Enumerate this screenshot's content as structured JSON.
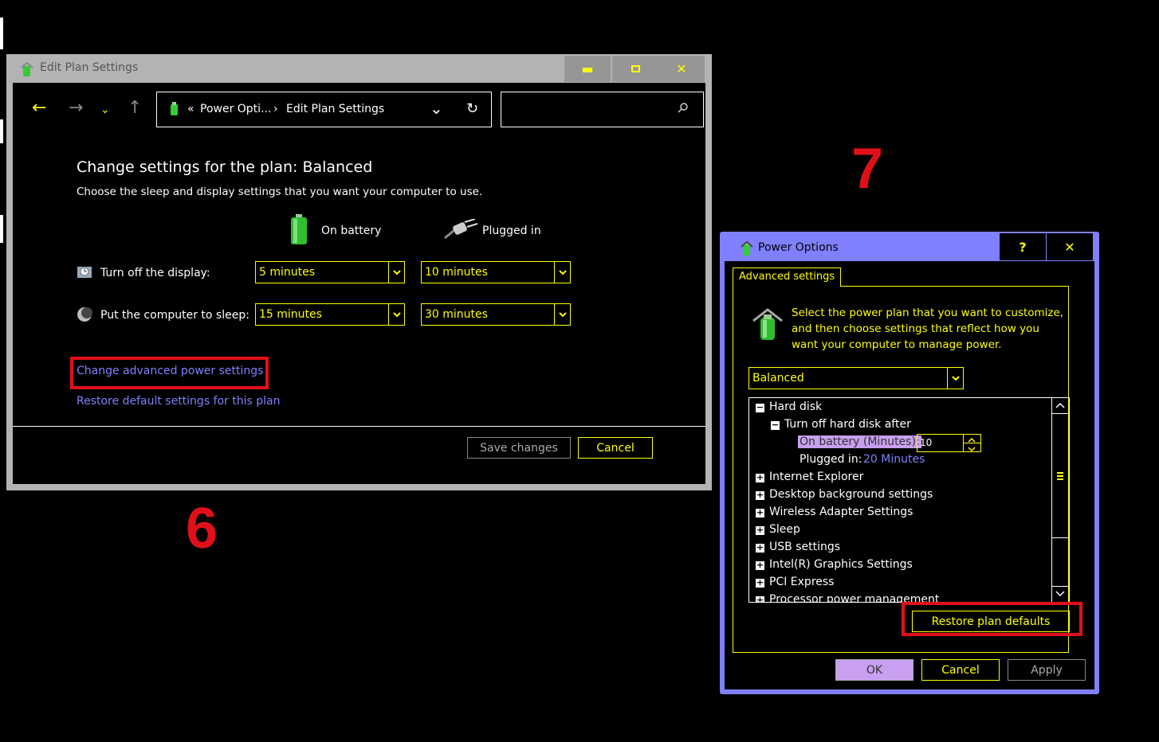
{
  "edit_window": {
    "title": "Edit Plan Settings",
    "address": {
      "chevrons": "«",
      "crumb1": "Power Opti...",
      "separator": "›",
      "crumb2": "Edit Plan Settings"
    },
    "heading": "Change settings for the plan: Balanced",
    "subheading": "Choose the sleep and display settings that you want your computer to use.",
    "col_battery": "On battery",
    "col_plugged": "Plugged in",
    "display_label": "Turn off the display:",
    "display_battery": "5 minutes",
    "display_plugged": "10 minutes",
    "sleep_label": "Put the computer to sleep:",
    "sleep_battery": "15 minutes",
    "sleep_plugged": "30 minutes",
    "link_advanced": "Change advanced power settings",
    "link_restore": "Restore default settings for this plan",
    "save_button": "Save changes",
    "cancel_button": "Cancel"
  },
  "annotations": {
    "step6": "6",
    "step7": "7"
  },
  "power_options": {
    "title": "Power Options",
    "help_button": "?",
    "tab": "Advanced settings",
    "intro": "Select the power plan that you want to customize, and then choose settings that reflect how you want your computer to manage power.",
    "plan": "Balanced",
    "tree": {
      "hard_disk": "Hard disk",
      "turn_off_after": "Turn off hard disk after",
      "on_battery_label": "On battery (Minutes):",
      "on_battery_value": "10",
      "plugged_in_label": "Plugged in:",
      "plugged_in_value": "20 Minutes",
      "items": [
        "Internet Explorer",
        "Desktop background settings",
        "Wireless Adapter Settings",
        "Sleep",
        "USB settings",
        "Intel(R) Graphics Settings",
        "PCI Express",
        "Processor power management"
      ]
    },
    "restore_button": "Restore plan defaults",
    "ok_button": "OK",
    "cancel_button": "Cancel",
    "apply_button": "Apply"
  },
  "colors": {
    "highlight": "#ffff00",
    "link": "#8080ff",
    "annotation_red": "#e0101a",
    "dialog_frame": "#8080ff"
  }
}
